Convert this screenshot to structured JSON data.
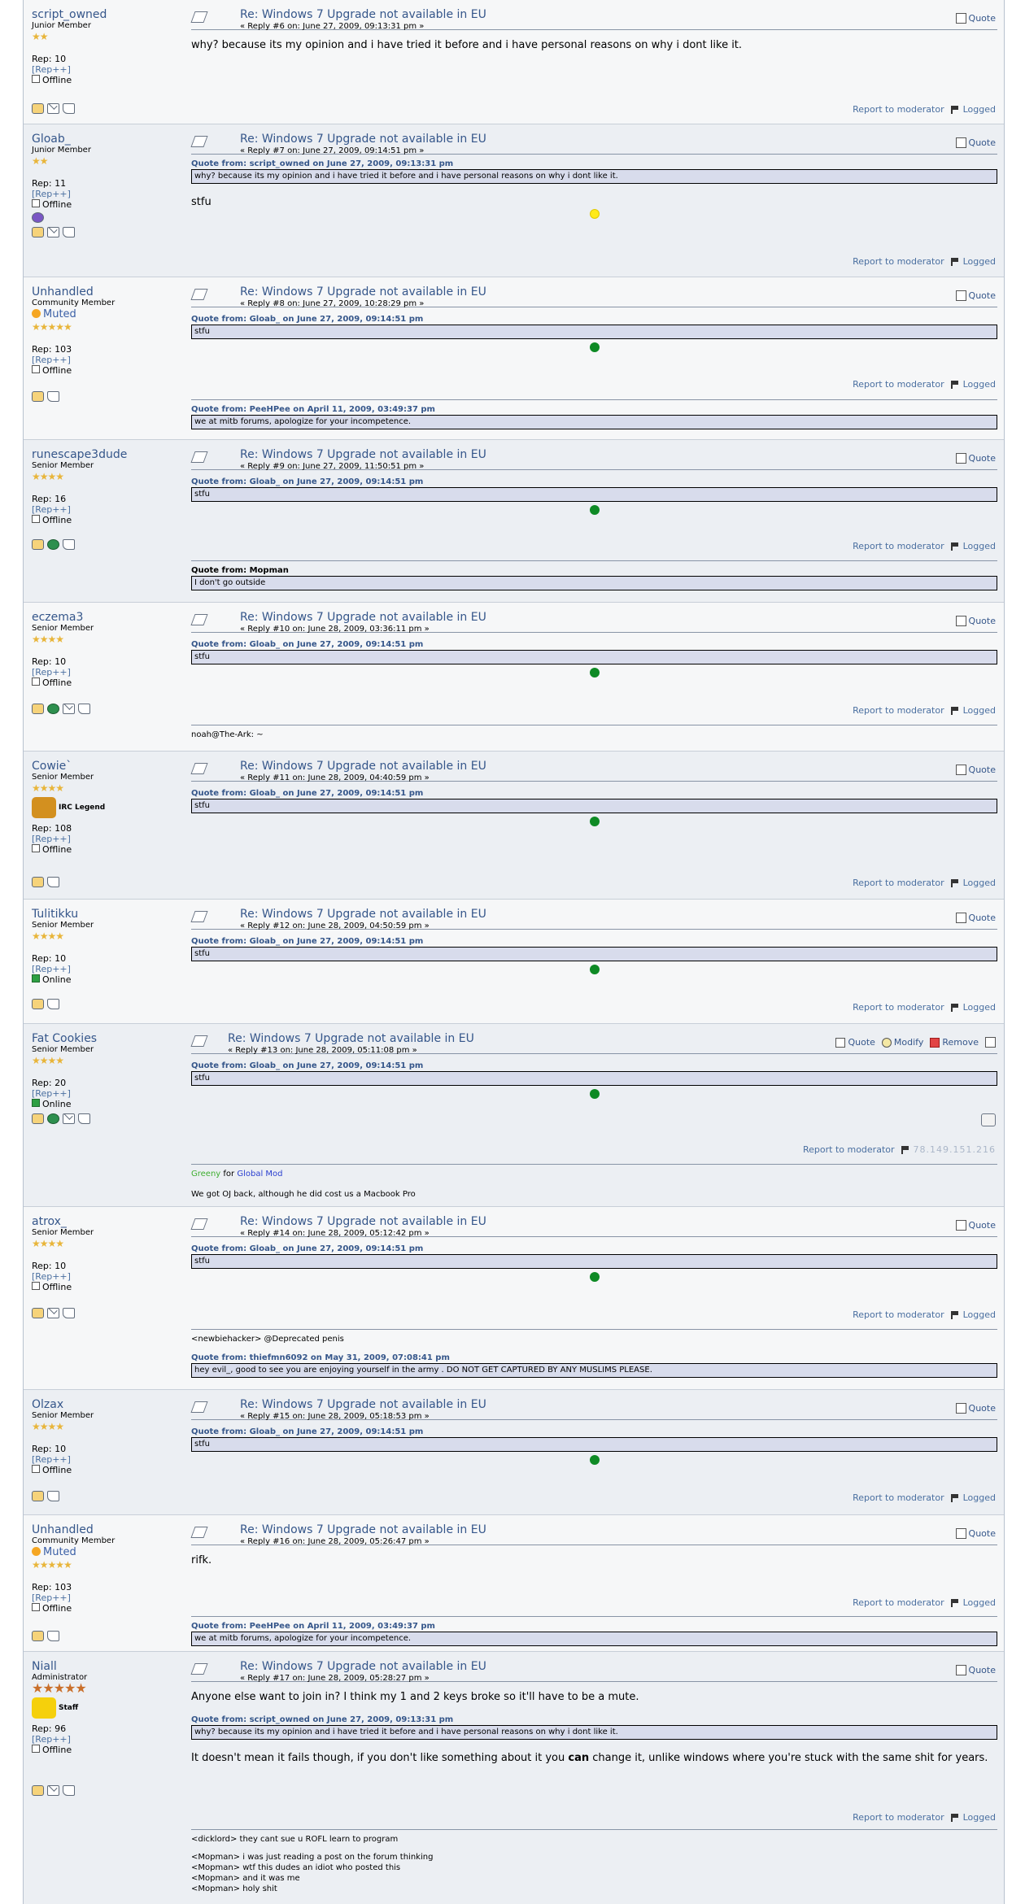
{
  "common": {
    "topic_title": "Re: Windows 7 Upgrade not available in EU",
    "quote_label": "Quote",
    "report_label": "Report to moderator",
    "logged_label": "Logged",
    "rep_link": "[Rep++]",
    "offline": "Offline",
    "online": "Online",
    "reply_word": "Reply",
    "on_word": "on:"
  },
  "posts": [
    {
      "user": "script_owned",
      "group": "Junior Member",
      "stars": "★★",
      "rep": "Rep: 10",
      "status": "Offline",
      "reply": "« Reply #6 on: June 27, 2009, 09:13:31 pm »",
      "body": "why? because its my opinion and i have tried it before and i have personal reasons on why i dont like it."
    },
    {
      "user": "Gloab_",
      "group": "Junior Member",
      "stars": "★★",
      "rep": "Rep: 11",
      "status": "Offline",
      "reply": "« Reply #7 on: June 27, 2009, 09:14:51 pm »",
      "quote_head": "Quote from: script_owned on June 27, 2009, 09:13:31 pm",
      "quote": "why? because its my opinion and i have tried it before and i have personal reasons on why i dont like it.",
      "body": "stfu"
    },
    {
      "user": "Unhandled",
      "group": "Community Member",
      "muted": "Muted",
      "stars": "★★★★★",
      "rep": "Rep: 103",
      "status": "Offline",
      "reply": "« Reply #8 on: June 27, 2009, 10:28:29 pm »",
      "quote_head": "Quote from: Gloab_ on June 27, 2009, 09:14:51 pm",
      "quote": "stfu",
      "sig_quote_head": "Quote from: PeeHPee on April 11, 2009, 03:49:37 pm",
      "sig_quote": "we at mitb forums, apologize for your incompetence."
    },
    {
      "user": "runescape3dude",
      "group": "Senior Member",
      "stars": "★★★★",
      "rep": "Rep: 16",
      "status": "Offline",
      "reply": "« Reply #9 on: June 27, 2009, 11:50:51 pm »",
      "quote_head": "Quote from: Gloab_ on June 27, 2009, 09:14:51 pm",
      "quote": "stfu",
      "sig_quote_head": "Quote from: Mopman",
      "sig_quote": "I don't go outside"
    },
    {
      "user": "eczema3",
      "group": "Senior Member",
      "stars": "★★★★",
      "rep": "Rep: 10",
      "status": "Offline",
      "reply": "« Reply #10 on: June 28, 2009, 03:36:11 pm »",
      "quote_head": "Quote from: Gloab_ on June 27, 2009, 09:14:51 pm",
      "quote": "stfu",
      "sig": "noah@The-Ark: ~"
    },
    {
      "user": "Cowie`",
      "group": "Senior Member",
      "stars": "★★★★",
      "badge": "IRC Legend",
      "rep": "Rep: 108",
      "status": "Offline",
      "reply": "« Reply #11 on: June 28, 2009, 04:40:59 pm »",
      "quote_head": "Quote from: Gloab_ on June 27, 2009, 09:14:51 pm",
      "quote": "stfu"
    },
    {
      "user": "Tulitikku",
      "group": "Senior Member",
      "stars": "★★★★",
      "rep": "Rep: 10",
      "status": "Online",
      "reply": "« Reply #12 on: June 28, 2009, 04:50:59 pm »",
      "quote_head": "Quote from: Gloab_ on June 27, 2009, 09:14:51 pm",
      "quote": "stfu"
    },
    {
      "user": "Fat Cookies",
      "group": "Senior Member",
      "stars": "★★★★",
      "rep": "Rep: 20",
      "status": "Online",
      "reply": "« Reply #13 on: June 28, 2009, 05:11:08 pm »",
      "quote_head": "Quote from: Gloab_ on June 27, 2009, 09:14:51 pm",
      "quote": "stfu",
      "modify": "Modify",
      "remove": "Remove",
      "ip": "78.149.151.216",
      "sig_green": "Greeny",
      "sig_for": "for",
      "sig_blue": "Global Mod",
      "sig2": "We got OJ back, although he did cost us a Macbook Pro"
    },
    {
      "user": "atrox_",
      "group": "Senior Member",
      "stars": "★★★★",
      "rep": "Rep: 10",
      "status": "Offline",
      "reply": "« Reply #14 on: June 28, 2009, 05:12:42 pm »",
      "quote_head": "Quote from: Gloab_ on June 27, 2009, 09:14:51 pm",
      "quote": "stfu",
      "sig": "<newbiehacker> @Deprecated penis",
      "sig_quote_head": "Quote from: thiefmn6092 on May 31, 2009, 07:08:41 pm",
      "sig_quote": "hey evil_, good to see you are enjoying yourself in the army . DO NOT GET CAPTURED BY ANY MUSLIMS PLEASE."
    },
    {
      "user": "Olzax",
      "group": "Senior Member",
      "stars": "★★★★",
      "rep": "Rep: 10",
      "status": "Offline",
      "reply": "« Reply #15 on: June 28, 2009, 05:18:53 pm »",
      "quote_head": "Quote from: Gloab_ on June 27, 2009, 09:14:51 pm",
      "quote": "stfu"
    },
    {
      "user": "Unhandled",
      "group": "Community Member",
      "muted": "Muted",
      "stars": "★★★★★",
      "rep": "Rep: 103",
      "status": "Offline",
      "reply": "« Reply #16 on: June 28, 2009, 05:26:47 pm »",
      "body": "rifk.",
      "sig_quote_head": "Quote from: PeeHPee on April 11, 2009, 03:49:37 pm",
      "sig_quote": "we at mitb forums, apologize for your incompetence."
    },
    {
      "user": "Niall",
      "group": "Administrator",
      "stars": "★★★★★",
      "badge": "Staff",
      "rep": "Rep: 96",
      "status": "Offline",
      "reply": "« Reply #17 on: June 28, 2009, 05:28:27 pm »",
      "body": "Anyone else want to join in? I think my 1 and 2 keys broke so it'll have to be a mute.",
      "quote_head": "Quote from: script_owned on June 27, 2009, 09:13:31 pm",
      "quote": "why? because its my opinion and i have tried it before and i have personal reasons on why i dont like it.",
      "body2_a": "It doesn't mean it fails though, if you don't like something about it you",
      "body2_b": "can",
      "body2_c": "change it, unlike windows where you're stuck with the same shit for years.",
      "sig_lines": [
        "<dicklord> they cant sue u ROFL learn to program",
        "",
        "<Mopman> i was just reading a post on the forum thinking",
        "<Mopman> wtf this dudes an idiot who posted this",
        "<Mopman> and it was me",
        "<Mopman> holy shit"
      ]
    }
  ]
}
